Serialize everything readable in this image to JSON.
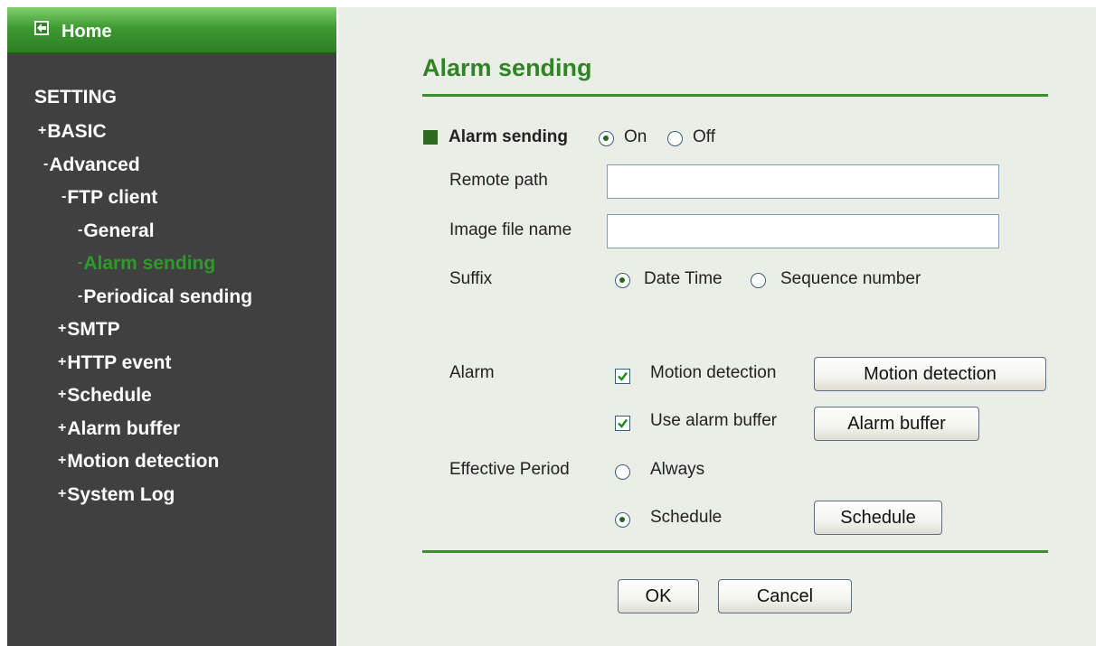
{
  "sidebar": {
    "home_label": "Home",
    "setting_label": "SETTING",
    "items": [
      {
        "prefix": "+",
        "label": "BASIC"
      },
      {
        "prefix": "-",
        "label": "Advanced"
      },
      {
        "prefix": "-",
        "label": "FTP client"
      },
      {
        "prefix": "-",
        "label": "General"
      },
      {
        "prefix": "-",
        "label": "Alarm sending"
      },
      {
        "prefix": "-",
        "label": "Periodical sending"
      },
      {
        "prefix": "+",
        "label": "SMTP"
      },
      {
        "prefix": "+",
        "label": "HTTP event"
      },
      {
        "prefix": "+",
        "label": "Schedule"
      },
      {
        "prefix": "+",
        "label": "Alarm buffer"
      },
      {
        "prefix": "+",
        "label": "Motion detection"
      },
      {
        "prefix": "+",
        "label": "System Log"
      }
    ]
  },
  "page": {
    "title": "Alarm sending",
    "alarm_sending": {
      "label": "Alarm sending",
      "on": "On",
      "off": "Off",
      "value": "On"
    },
    "remote_path": {
      "label": "Remote path",
      "value": ""
    },
    "image_file_name": {
      "label": "Image file name",
      "value": ""
    },
    "suffix": {
      "label": "Suffix",
      "date_time": "Date Time",
      "sequence": "Sequence number",
      "value": "Date Time"
    },
    "alarm": {
      "label": "Alarm",
      "motion_detection": {
        "label": "Motion detection",
        "checked": true,
        "button": "Motion detection"
      },
      "alarm_buffer": {
        "label": "Use alarm buffer",
        "checked": true,
        "button": "Alarm buffer"
      }
    },
    "effective_period": {
      "label": "Effective Period",
      "always": "Always",
      "schedule": "Schedule",
      "schedule_button": "Schedule",
      "value": "Schedule"
    },
    "ok_label": "OK",
    "cancel_label": "Cancel"
  },
  "colors": {
    "accent": "#2f8526",
    "sidebar_bg": "#404040",
    "panel_bg": "#eaeee6",
    "active_item": "#2e9a2a"
  }
}
